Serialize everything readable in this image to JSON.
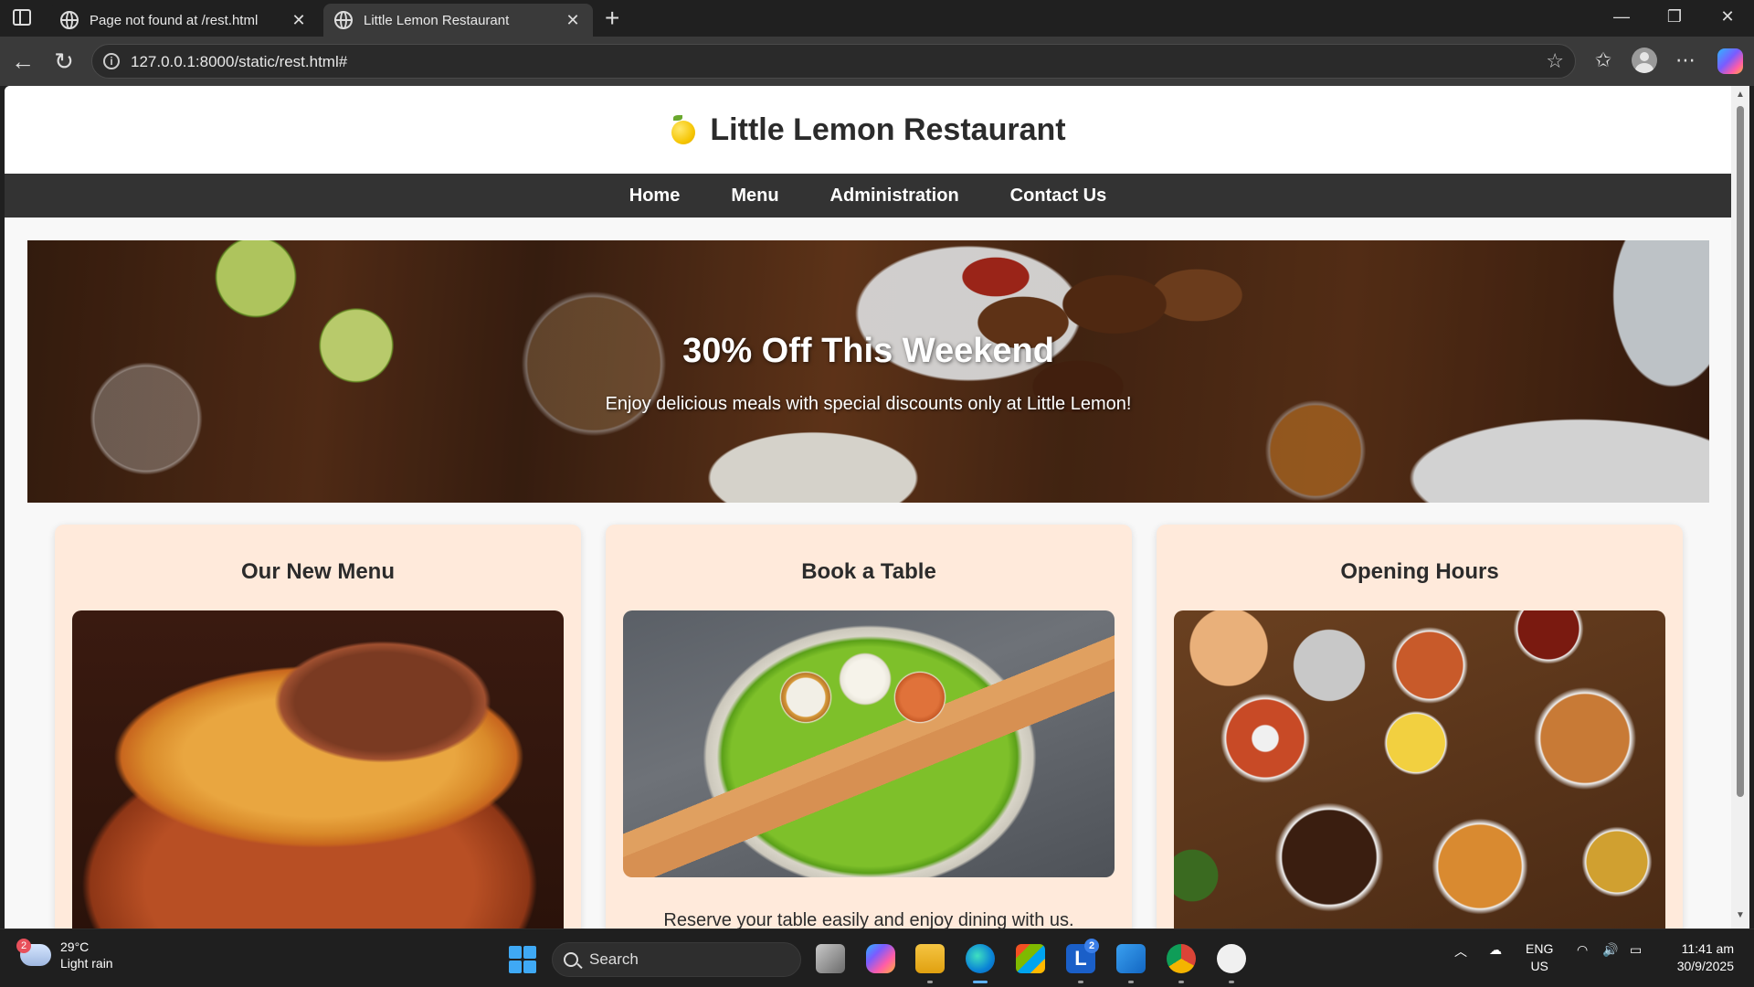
{
  "browser": {
    "tabs": [
      {
        "title": "Page not found at /rest.html",
        "active": false
      },
      {
        "title": "Little Lemon Restaurant",
        "active": true
      }
    ],
    "url": "127.0.0.1:8000/static/rest.html#"
  },
  "site": {
    "title": "Little Lemon Restaurant",
    "nav": [
      "Home",
      "Menu",
      "Administration",
      "Contact Us"
    ],
    "hero": {
      "title": "30% Off This Weekend",
      "subtitle": "Enjoy delicious meals with special discounts only at Little Lemon!"
    },
    "cards": [
      {
        "title": "Our New Menu",
        "text": ""
      },
      {
        "title": "Book a Table",
        "text": "Reserve your table easily and enjoy dining with us."
      },
      {
        "title": "Opening Hours",
        "text": ""
      }
    ]
  },
  "taskbar": {
    "weather": {
      "temp": "29°C",
      "desc": "Light rain",
      "badge": "2"
    },
    "search_label": "Search",
    "outlook_badge": "2",
    "lang": {
      "line1": "ENG",
      "line2": "US"
    },
    "clock": {
      "time": "11:41 am",
      "date": "30/9/2025"
    }
  },
  "colors": {
    "nav_bg": "#333333",
    "card_bg": "#ffeadb",
    "accent": "#f5c400"
  }
}
